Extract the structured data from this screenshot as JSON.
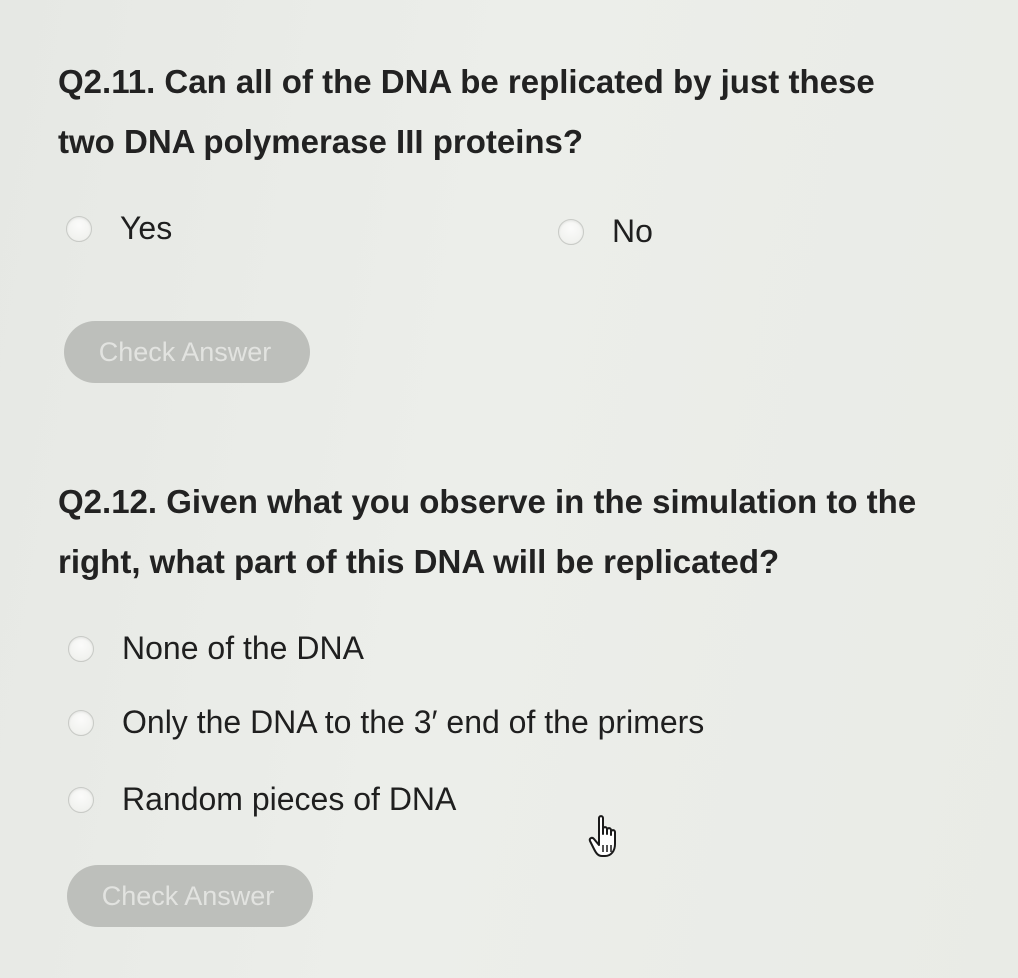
{
  "q11": {
    "line1": "Q2.11. Can all of the DNA be replicated by just these",
    "line2": "two DNA polymerase III proteins?",
    "options": [
      {
        "label": "Yes"
      },
      {
        "label": "No"
      }
    ],
    "check_label": "Check Answer"
  },
  "q12": {
    "line1": "Q2.12. Given what you observe in the simulation to the",
    "line2": "right, what part of this DNA will be replicated?",
    "options": [
      {
        "label": "None of the DNA"
      },
      {
        "label": "Only the DNA to the 3′ end of the primers"
      },
      {
        "label": "Random pieces of DNA"
      }
    ],
    "check_label": "Check Answer"
  },
  "cursor": {
    "icon": "hand-pointer-icon"
  },
  "colors": {
    "background": "#e9ebe7",
    "button_disabled": "#bdbfbb",
    "button_text": "#e2e3e0"
  }
}
